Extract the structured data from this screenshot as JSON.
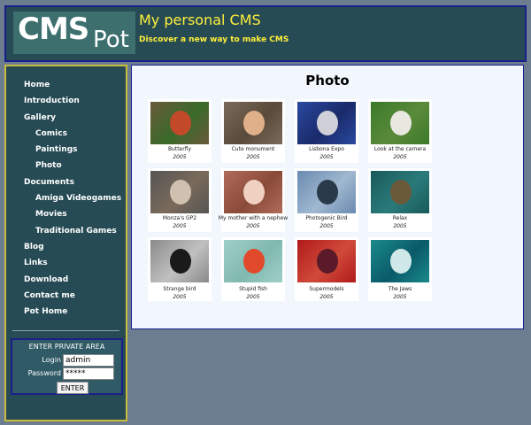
{
  "header": {
    "logo_main": "CMS",
    "logo_sub": "Pot",
    "title": "My personal CMS",
    "subtitle": "Discover a new way to make CMS"
  },
  "nav": [
    {
      "label": "Home",
      "level": 0
    },
    {
      "label": "Introduction",
      "level": 0
    },
    {
      "label": "Gallery",
      "level": 0
    },
    {
      "label": "Comics",
      "level": 1
    },
    {
      "label": "Paintings",
      "level": 1
    },
    {
      "label": "Photo",
      "level": 1
    },
    {
      "label": "Documents",
      "level": 0
    },
    {
      "label": "Amiga Videogames",
      "level": 1
    },
    {
      "label": "Movies",
      "level": 1
    },
    {
      "label": "Traditional Games",
      "level": 1
    },
    {
      "label": "Blog",
      "level": 0
    },
    {
      "label": "Links",
      "level": 0
    },
    {
      "label": "Download",
      "level": 0
    },
    {
      "label": "Contact me",
      "level": 0
    },
    {
      "label": "Pot Home",
      "level": 0
    }
  ],
  "login": {
    "title": "ENTER PRIVATE AREA",
    "login_label": "Login",
    "login_value": "admin",
    "password_label": "Password",
    "password_value": "*****",
    "enter_label": "ENTER"
  },
  "main": {
    "title": "Photo"
  },
  "photos": [
    {
      "caption": "Butterfly",
      "year": "2005",
      "colors": [
        "#6a5a3a",
        "#c24a2a",
        "#3a6a2a"
      ]
    },
    {
      "caption": "Cute monument",
      "year": "2005",
      "colors": [
        "#7a6a5a",
        "#e0b08a",
        "#5a4a3a"
      ]
    },
    {
      "caption": "Lisbona Expo",
      "year": "2005",
      "colors": [
        "#2a4aa0",
        "#d0d0d8",
        "#1a2a6a"
      ]
    },
    {
      "caption": "Look at the camera",
      "year": "2005",
      "colors": [
        "#3a7a2a",
        "#e8e8e0",
        "#5a8a3a"
      ]
    },
    {
      "caption": "Monza's GP2",
      "year": "2005",
      "colors": [
        "#555555",
        "#d0c0b0",
        "#7a6a5a"
      ]
    },
    {
      "caption": "My mother with a nephew",
      "year": "2005",
      "colors": [
        "#b06a5a",
        "#f0d0c0",
        "#8a4a3a"
      ]
    },
    {
      "caption": "Photogenic Bird",
      "year": "2005",
      "colors": [
        "#6a8ab0",
        "#2a3a4a",
        "#a0b8d0"
      ]
    },
    {
      "caption": "Relax",
      "year": "2005",
      "colors": [
        "#1a5a5a",
        "#6a5a3a",
        "#2a7a7a"
      ]
    },
    {
      "caption": "Strange bird",
      "year": "2005",
      "colors": [
        "#8a8a8a",
        "#1a1a1a",
        "#c0c0c0"
      ]
    },
    {
      "caption": "Stupid fish",
      "year": "2005",
      "colors": [
        "#a0d0c8",
        "#e04a2a",
        "#80b8b0"
      ]
    },
    {
      "caption": "Supermodels",
      "year": "2005",
      "colors": [
        "#b01a1a",
        "#5a1a2a",
        "#d04a3a"
      ]
    },
    {
      "caption": "The Jaws",
      "year": "2005",
      "colors": [
        "#1a8a8a",
        "#d0e8e8",
        "#0a5a6a"
      ]
    }
  ]
}
